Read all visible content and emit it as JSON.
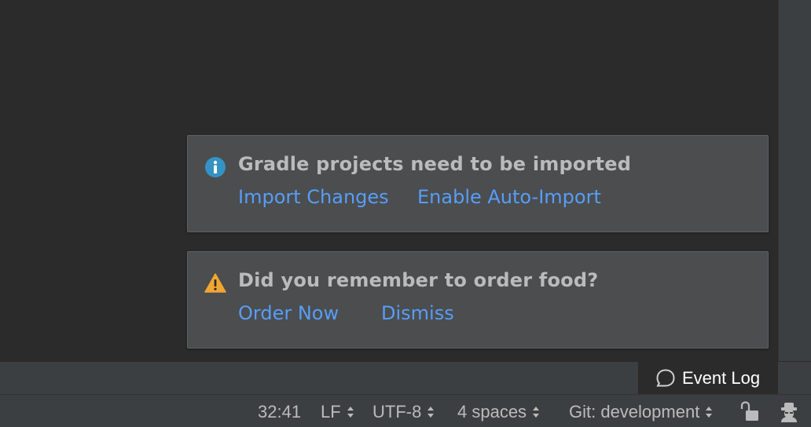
{
  "notifications": [
    {
      "icon": "info-icon",
      "title": "Gradle projects need to be imported",
      "actions": [
        "Import Changes",
        "Enable Auto-Import"
      ]
    },
    {
      "icon": "warning-icon",
      "title": "Did you remember to order food?",
      "actions": [
        "Order Now",
        "Dismiss"
      ]
    }
  ],
  "tool_strip": {
    "event_log_label": "Event Log",
    "event_log_icon": "speech-bubble-icon"
  },
  "status_bar": {
    "caret_position": "32:41",
    "line_separator": "LF",
    "encoding": "UTF-8",
    "indent": "4 spaces",
    "vcs_branch": "Git: development",
    "lock_icon": "unlocked-padlock-icon",
    "inspector_icon": "hector-inspector-icon"
  },
  "colors": {
    "background": "#2b2b2b",
    "panel": "#4b4d4f",
    "link": "#589df6",
    "text": "#bbbbbb",
    "info": "#3592c4",
    "warning": "#f0a732"
  }
}
